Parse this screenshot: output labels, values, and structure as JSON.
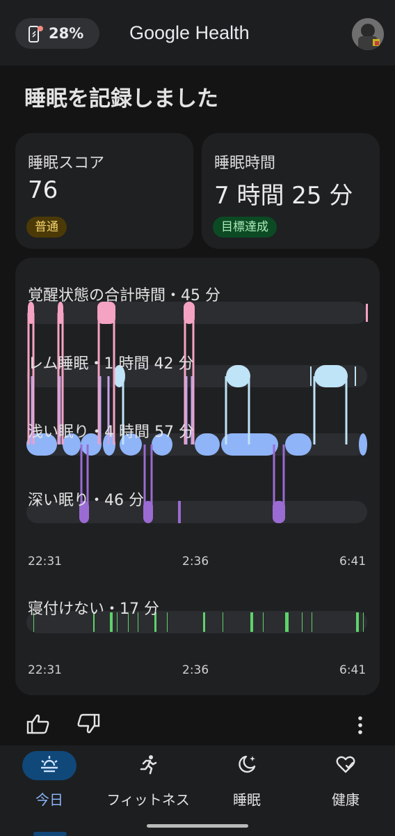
{
  "status": {
    "battery": "28%"
  },
  "app": {
    "title": "Google Health"
  },
  "page": {
    "heading": "睡眠を記録しました"
  },
  "score_card": {
    "label": "睡眠スコア",
    "value": "76",
    "badge": "普通"
  },
  "duration_card": {
    "label": "睡眠時間",
    "value": "7 時間 25 分",
    "badge": "目標達成"
  },
  "stages": {
    "awake": "覚醒状態の合計時間・45 分",
    "rem": "レム睡眠・1 時間 42 分",
    "light": "浅い眠り・4 時間 57 分",
    "deep": "深い眠り・46 分"
  },
  "axis": {
    "start": "22:31",
    "mid": "2:36",
    "end": "6:41"
  },
  "restless": {
    "label": "寝付けない・17 分"
  },
  "nav": [
    {
      "label": "今日",
      "icon": "sunrise-icon",
      "active": true
    },
    {
      "label": "フィットネス",
      "icon": "running-icon"
    },
    {
      "label": "睡眠",
      "icon": "moon-icon"
    },
    {
      "label": "健康",
      "icon": "heart-icon"
    }
  ],
  "colors": {
    "awake": "#f5a3c2",
    "rem": "#bfe3f7",
    "rem_thin": "#c5a3e8",
    "light": "#8fb4f8",
    "deep": "#9a6bd3",
    "restless": "#5ed36b",
    "track": "#2c2d30",
    "accent": "#10487a"
  }
}
